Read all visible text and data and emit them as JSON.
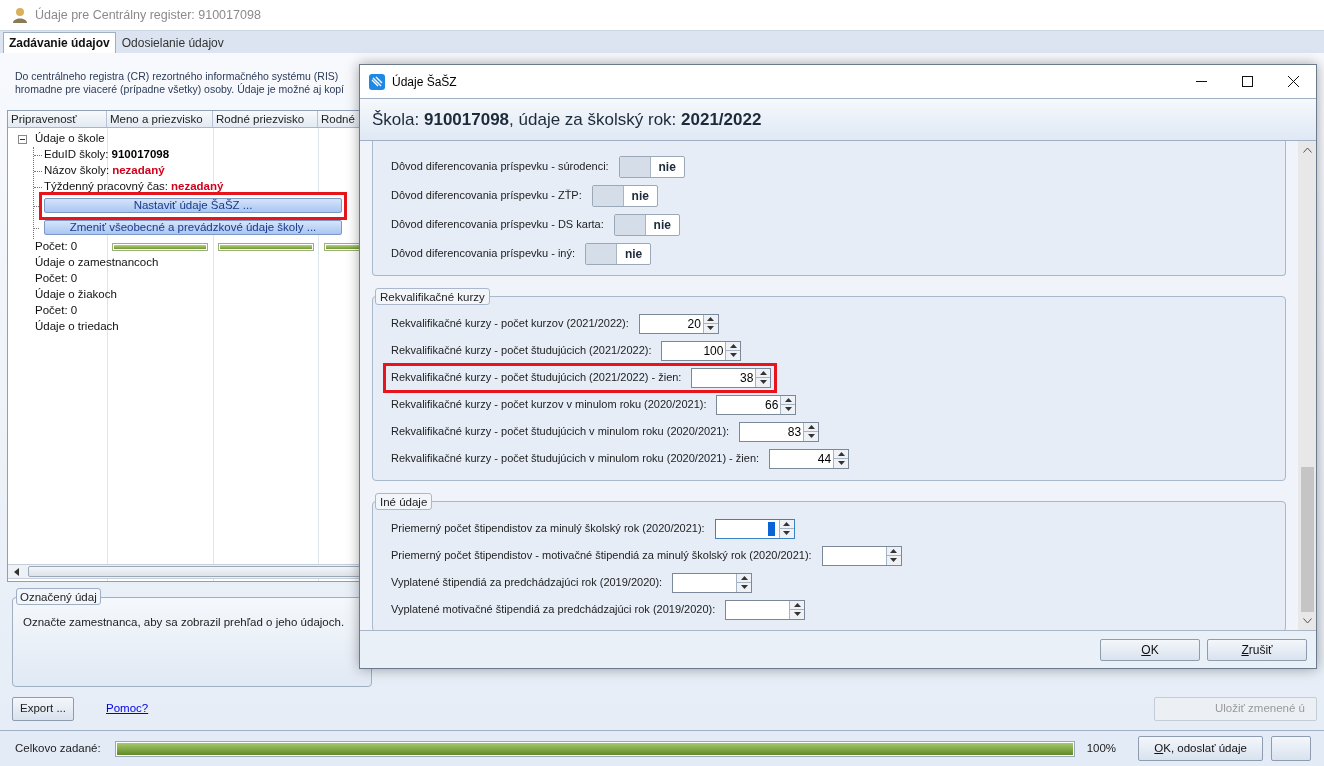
{
  "main_window": {
    "title": "Údaje pre Centrálny register: 910017098",
    "tabs": [
      {
        "label": "Zadávanie údajov",
        "selected": true
      },
      {
        "label": "Odosielanie údajov",
        "selected": false
      }
    ],
    "info_lines": [
      "Do centrálneho registra (CR) rezortného informačného systému (RIS)",
      "hromadne pre viaceré (prípadne všetky) osoby. Údaje je možné aj kopí"
    ],
    "grid": {
      "columns": [
        "Pripravenosť",
        "Meno a priezvisko",
        "Rodné priezvisko",
        "Rodné"
      ],
      "tree": {
        "label": "Údaje o škole",
        "expanded": true,
        "children": [
          {
            "kind": "field",
            "label": "EduID školy:",
            "value": "910017098",
            "missing": false
          },
          {
            "kind": "field",
            "label": "Názov školy:",
            "value": "nezadaný",
            "missing": true
          },
          {
            "kind": "field",
            "label": "Týždenný pracovný čas:",
            "value": "nezadaný",
            "missing": true
          },
          {
            "kind": "button",
            "label": "Nastaviť údaje ŠaŠZ ...",
            "highlighted": true
          },
          {
            "kind": "button",
            "label": "Zmeniť všeobecné a prevádzkové údaje školy ...",
            "highlighted": false
          }
        ]
      },
      "rows": [
        {
          "label": "Počet: 0",
          "bars": [
            {
              "level": 1
            },
            {
              "level": 1
            },
            {
              "level": 1
            }
          ]
        },
        {
          "label": "Údaje o zamestnancoch"
        },
        {
          "label": "Počet: 0"
        },
        {
          "label": "Údaje o žiakoch"
        },
        {
          "label": "Počet: 0"
        },
        {
          "label": "Údaje o triedach"
        }
      ]
    },
    "selected_item": {
      "title": "Označený údaj",
      "text": "Označte zamestnanca, aby sa zobrazil prehľad o jeho údajoch."
    },
    "export_button": "Export ...",
    "help_link": "Pomoc?",
    "save_button": {
      "label": "Uložiť zmenené ú",
      "disabled": true
    },
    "status_bar": {
      "label": "Celkovo zadané:",
      "progress": {
        "level": 1
      },
      "percent": "100%",
      "send_button": {
        "label": "OK, odoslať údaje",
        "underline_first": true
      }
    }
  },
  "dialog": {
    "title": "Údaje ŠaŠZ",
    "heading": "Škola: **910017098**, údaje za školský rok: **2021/2022**",
    "sections": [
      {
        "kind": "toggles",
        "rows": [
          {
            "label": "Dôvod diferencovania príspevku - súrodenci:",
            "on": false,
            "text": "nie"
          },
          {
            "label": "Dôvod diferencovania príspevku - ZŤP:",
            "on": false,
            "text": "nie"
          },
          {
            "label": "Dôvod diferencovania príspevku - DS karta:",
            "on": false,
            "text": "nie"
          },
          {
            "label": "Dôvod diferencovania príspevku - iný:",
            "on": false,
            "text": "nie"
          }
        ]
      },
      {
        "kind": "numbers",
        "title": "Rekvalifikačné kurzy",
        "rows": [
          {
            "label": "Rekvalifikačné kurzy - počet kurzov (2021/2022):",
            "value": "20",
            "highlighted": false,
            "focused": false
          },
          {
            "label": "Rekvalifikačné kurzy - počet študujúcich (2021/2022):",
            "value": "100",
            "highlighted": false,
            "focused": false
          },
          {
            "label": "Rekvalifikačné kurzy - počet študujúcich (2021/2022) - žien:",
            "value": "38",
            "highlighted": true,
            "focused": false
          },
          {
            "label": "Rekvalifikačné kurzy - počet kurzov v minulom roku (2020/2021):",
            "value": "66",
            "highlighted": false,
            "focused": false
          },
          {
            "label": "Rekvalifikačné kurzy - počet študujúcich v minulom roku (2020/2021):",
            "value": "83",
            "highlighted": false,
            "focused": false
          },
          {
            "label": "Rekvalifikačné kurzy - počet študujúcich v minulom roku (2020/2021) - žien:",
            "value": "44",
            "highlighted": false,
            "focused": false
          }
        ]
      },
      {
        "kind": "numbers",
        "title": "Iné údaje",
        "rows": [
          {
            "label": "Priemerný počet štipendistov za minulý školský rok (2020/2021):",
            "highlighted": false,
            "focused": true
          },
          {
            "label": "Priemerný počet štipendistov - motivačné štipendiá za minulý školský rok (2020/2021):",
            "highlighted": false,
            "focused": false
          },
          {
            "label": "Vyplatené štipendiá za predchádzajúci rok (2019/2020):",
            "highlighted": false,
            "focused": false
          },
          {
            "label": "Vyplatené motivačné štipendiá za predchádzajúci rok (2019/2020):",
            "highlighted": false,
            "focused": false
          }
        ]
      }
    ],
    "buttons": [
      {
        "label": "OK",
        "underline_first": true
      },
      {
        "label": "Zrušiť",
        "underline_first": true
      }
    ]
  }
}
